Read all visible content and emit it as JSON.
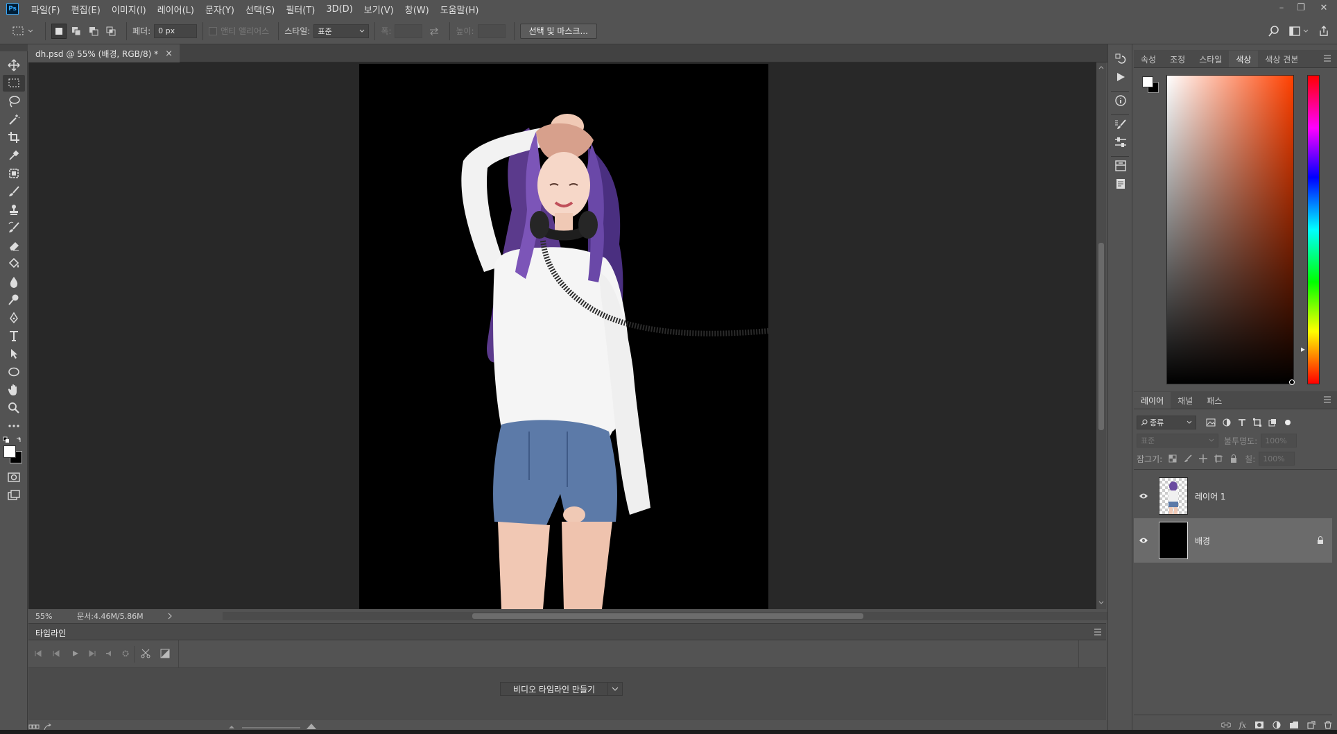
{
  "app": {
    "logo": "Ps"
  },
  "menu": [
    "파일(F)",
    "편집(E)",
    "이미지(I)",
    "레이어(L)",
    "문자(Y)",
    "선택(S)",
    "필터(T)",
    "3D(D)",
    "보기(V)",
    "창(W)",
    "도움말(H)"
  ],
  "window_controls": {
    "minimize": "–",
    "restore": "❐",
    "close": "✕"
  },
  "options": {
    "feather_label": "페더:",
    "feather_value": "0 px",
    "antialias_label": "앤티 앨리어스",
    "style_label": "스타일:",
    "style_value": "표준",
    "width_label": "폭:",
    "height_label": "높이:",
    "select_mask_button": "선택 및 마스크..."
  },
  "document": {
    "tab_title": "dh.psd @ 55% (배경, RGB/8) *",
    "close": "×",
    "zoom": "55%",
    "doc_info": "문서:4.46M/5.86M"
  },
  "timeline": {
    "title": "타임라인",
    "create_button": "비디오 타임라인 만들기"
  },
  "panels": {
    "color_tabs": [
      "속성",
      "조정",
      "스타일",
      "색상",
      "색상 견본"
    ],
    "color_active_tab": "색상",
    "layers_tabs": [
      "레이어",
      "채널",
      "패스"
    ],
    "layers_active_tab": "레이어",
    "filter_kind": "종류",
    "blend_mode": "표준",
    "opacity_label": "불투명도:",
    "opacity_value": "100%",
    "lock_label": "잠그기:",
    "fill_label": "칠:",
    "fill_value": "100%",
    "layers": [
      {
        "name": "레이어 1",
        "visible": true,
        "selected": false,
        "locked": false
      },
      {
        "name": "배경",
        "visible": true,
        "selected": true,
        "locked": true
      }
    ]
  },
  "colors": {
    "foreground": "#ffffff",
    "background": "#000000"
  }
}
